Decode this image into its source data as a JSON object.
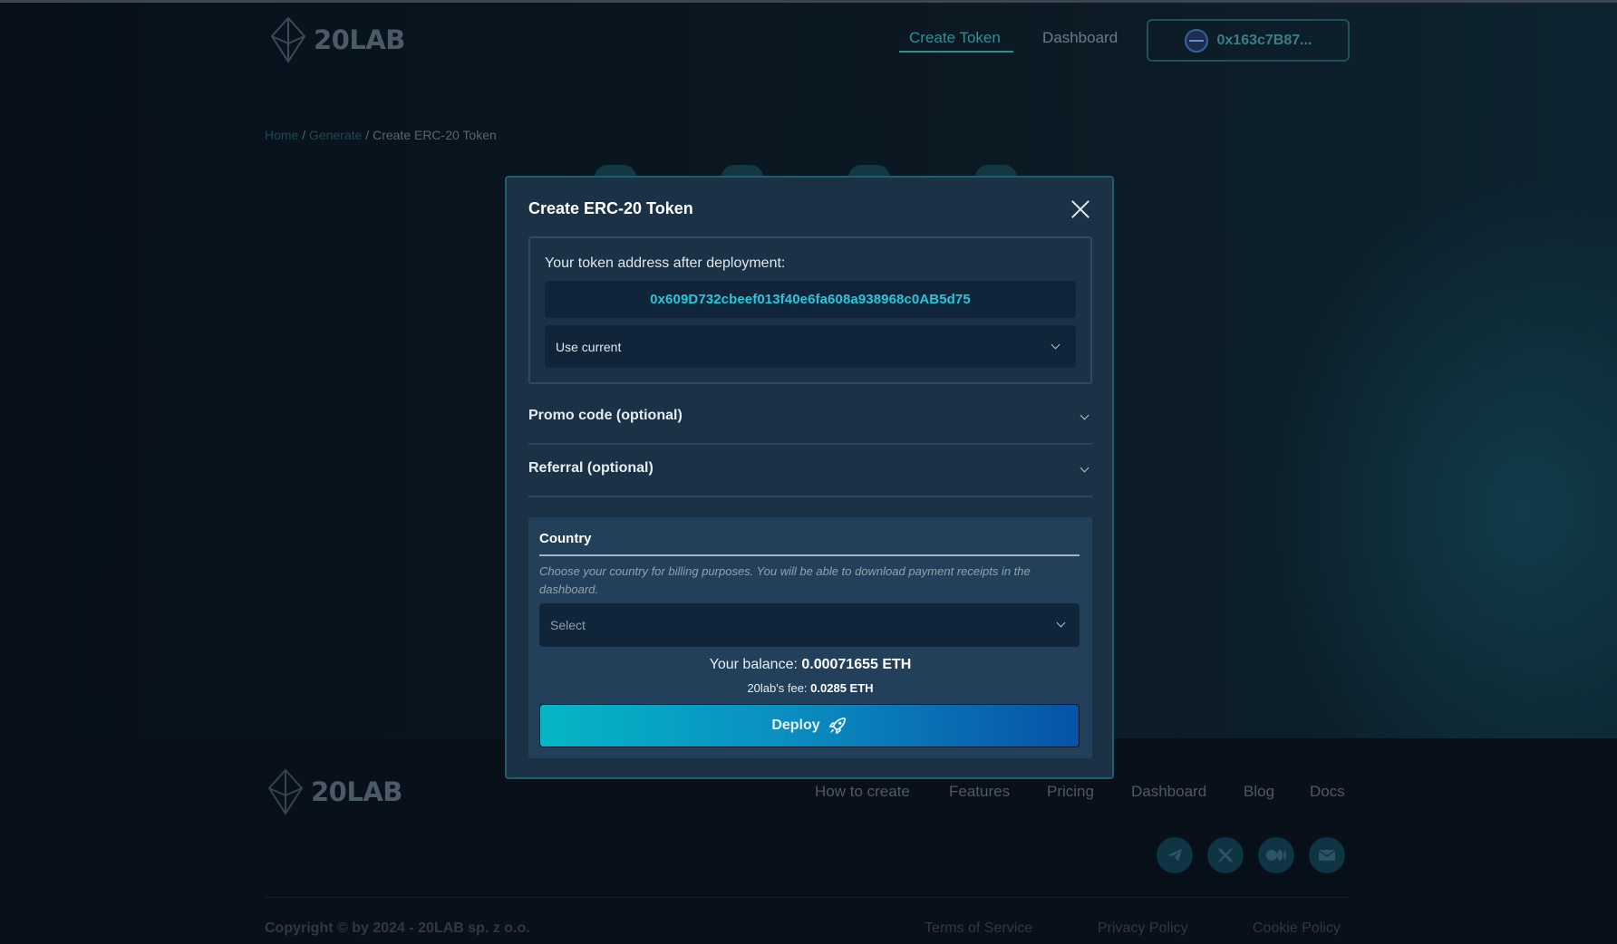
{
  "header": {
    "logo_text": "20LAB",
    "nav": {
      "create_token": "Create Token",
      "dashboard": "Dashboard"
    },
    "wallet_address": "0x163c7B87..."
  },
  "breadcrumb": {
    "home": "Home",
    "sep1": " / ",
    "generate": "Generate",
    "sep2": " / ",
    "current": "Create ERC-20 Token"
  },
  "modal": {
    "title": "Create ERC-20 Token",
    "token_address_label": "Your token address after deployment:",
    "token_address": "0x609D732cbeef013f40e6fa608a938968c0AB5d75",
    "address_mode_selected": "Use current",
    "promo_label": "Promo code (optional)",
    "referral_label": "Referral (optional)",
    "country": {
      "title": "Country",
      "help": "Choose your country for billing purposes. You will be able to download payment receipts in the dashboard.",
      "placeholder": "Select"
    },
    "balance_label": "Your balance: ",
    "balance_value": "0.00071655 ETH",
    "fee_label": "20lab's fee: ",
    "fee_value": "0.0285 ETH",
    "deploy_label": "Deploy"
  },
  "footer": {
    "logo_text": "20LAB",
    "links": [
      "How to create",
      "Features",
      "Pricing",
      "Dashboard",
      "Blog",
      "Docs"
    ],
    "socials": [
      "telegram-icon",
      "x-icon",
      "medium-icon",
      "email-icon"
    ],
    "copyright": "Copyright © by 2024 - 20LAB sp. z o.o.",
    "legal": [
      "Terms of Service",
      "Privacy Policy",
      "Cookie Policy"
    ]
  },
  "colors": {
    "accent": "#29c6dd",
    "deploy_start": "#05b6c6",
    "deploy_end": "#0752a8",
    "modal_bg": "#1a3146"
  }
}
